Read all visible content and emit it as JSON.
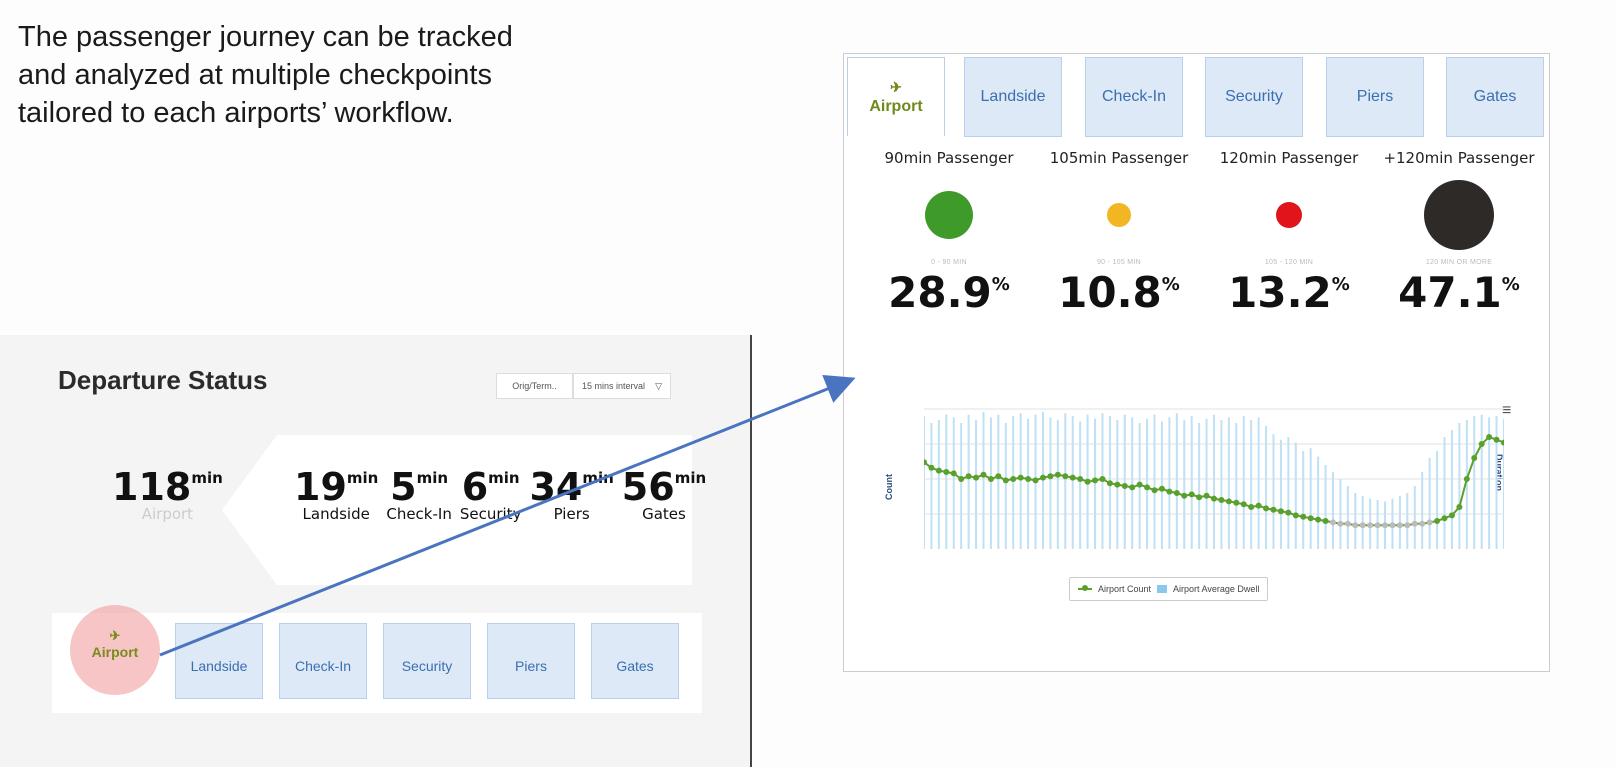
{
  "intro": {
    "line1": "The passenger journey can be tracked",
    "line2": "and analyzed at multiple checkpoints",
    "line3": "tailored to each airports’ workflow."
  },
  "left": {
    "title": "Departure Status",
    "filter1": "Orig/Term..",
    "filter2": "15 mins interval",
    "filter2_icon": "filter-icon",
    "total": {
      "value": "118",
      "unit": "min",
      "label": "Airport"
    },
    "segments": [
      {
        "value": "19",
        "unit": "min",
        "label": "Landside"
      },
      {
        "value": "5",
        "unit": "min",
        "label": "Check-In"
      },
      {
        "value": "6",
        "unit": "min",
        "label": "Security"
      },
      {
        "value": "34",
        "unit": "min",
        "label": "Piers"
      },
      {
        "value": "56",
        "unit": "min",
        "label": "Gates"
      }
    ],
    "tabs": [
      "Airport",
      "Landside",
      "Check-In",
      "Security",
      "Piers",
      "Gates"
    ],
    "plane_icon": "plane-icon"
  },
  "right": {
    "tabs": [
      "Airport",
      "Landside",
      "Check-In",
      "Security",
      "Piers",
      "Gates"
    ],
    "categories": [
      {
        "title": "90min Passenger",
        "range": "0 - 90 MIN",
        "pct": "28.9",
        "color": "#3e9b2a",
        "dot_level": 1.0
      },
      {
        "title": "105min Passenger",
        "range": "90 - 105 MIN",
        "pct": "10.8",
        "color": "#f3b623",
        "dot_level": 0.33
      },
      {
        "title": "120min Passenger",
        "range": "105 - 120 MIN",
        "pct": "13.2",
        "color": "#e0141a",
        "dot_level": 0.4
      },
      {
        "title": "+120min Passenger",
        "range": "120 MIN OR MORE",
        "pct": "47.1",
        "color": "#2d2a28",
        "dot_level": 1.6
      }
    ],
    "pct_sign": "%",
    "axis_left": "Count",
    "axis_right": "Duration",
    "legend_count": "Airport Count",
    "legend_dwell": "Airport Average Dwell",
    "menu_icon": "hamburger-menu-icon"
  },
  "chart_data": {
    "type": "line",
    "series": [
      {
        "name": "Airport Count",
        "values": [
          62,
          58,
          56,
          55,
          54,
          50,
          52,
          51,
          53,
          50,
          52,
          49,
          50,
          51,
          50,
          49,
          51,
          52,
          53,
          52,
          51,
          50,
          48,
          49,
          50,
          47,
          46,
          45,
          44,
          46,
          44,
          42,
          43,
          41,
          40,
          38,
          39,
          37,
          38,
          36,
          35,
          34,
          33,
          32,
          30,
          31,
          29,
          28,
          27,
          26,
          24,
          23,
          22,
          21,
          20,
          19,
          18,
          18,
          17,
          17,
          17,
          17,
          17,
          17,
          17,
          17,
          18,
          18,
          19,
          20,
          22,
          24,
          30,
          50,
          65,
          75,
          80,
          78,
          76
        ]
      },
      {
        "name": "Airport Average Dwell",
        "values": [
          95,
          90,
          92,
          96,
          94,
          90,
          96,
          92,
          98,
          94,
          96,
          90,
          95,
          97,
          93,
          96,
          98,
          94,
          92,
          97,
          95,
          91,
          96,
          93,
          97,
          95,
          92,
          96,
          94,
          90,
          93,
          96,
          91,
          94,
          97,
          92,
          95,
          90,
          93,
          96,
          92,
          94,
          90,
          95,
          92,
          94,
          88,
          82,
          78,
          80,
          76,
          70,
          72,
          66,
          60,
          55,
          50,
          45,
          40,
          38,
          36,
          35,
          34,
          36,
          38,
          40,
          45,
          55,
          65,
          70,
          80,
          85,
          90,
          92,
          95,
          96,
          94,
          95,
          93
        ]
      }
    ],
    "ylim": [
      0,
      100
    ],
    "grid": true,
    "legend_position": "bottom"
  }
}
